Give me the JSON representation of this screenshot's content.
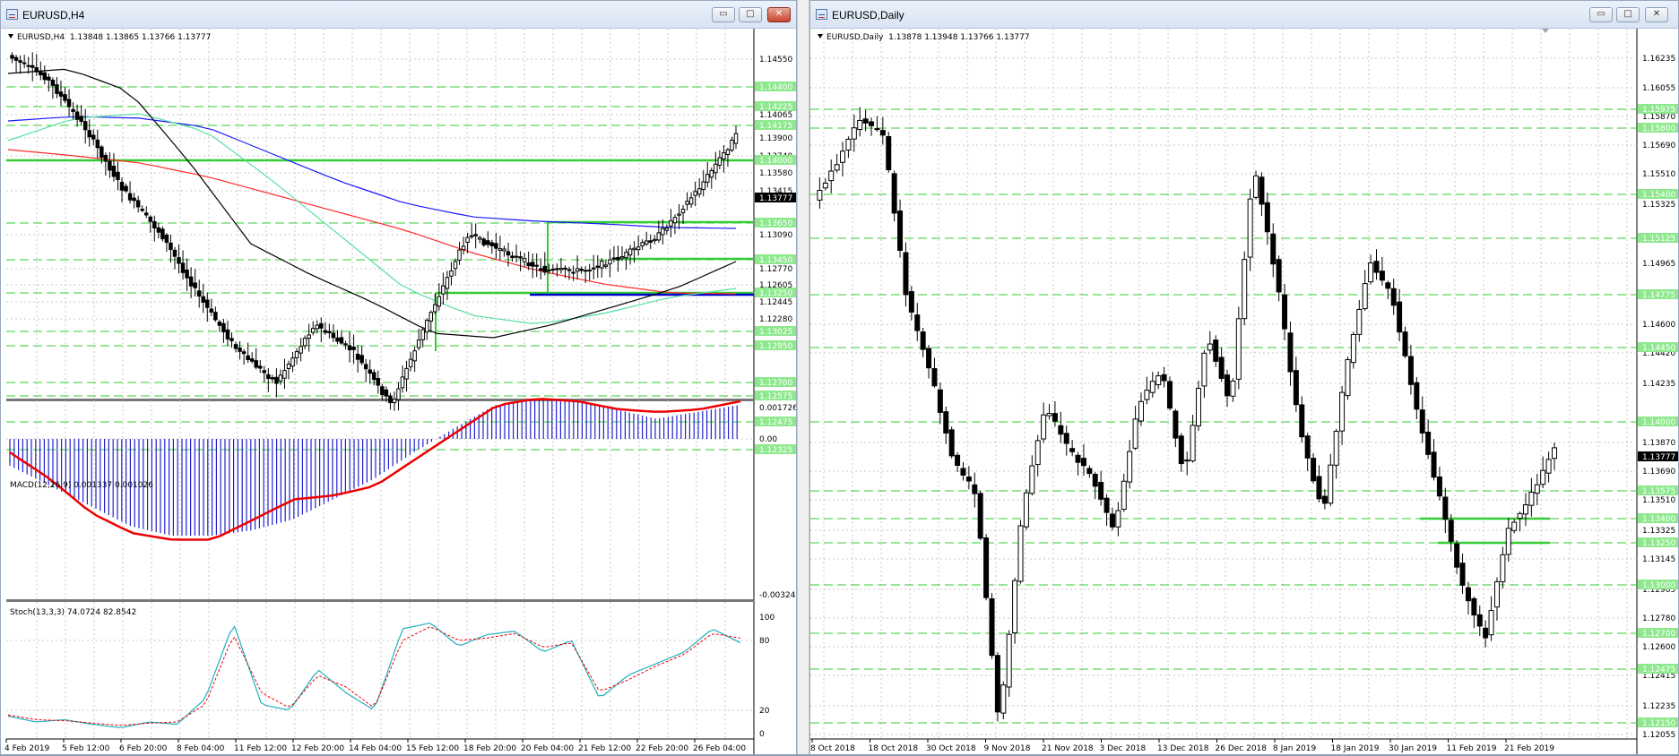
{
  "left_window": {
    "title": "EURUSD,H4",
    "info_symbol": "EURUSD,H4",
    "info_ohlc": "1.13848 1.13865 1.13766 1.13777",
    "price_labels": [
      "1.14550",
      "1.14225",
      "1.14065",
      "1.13900",
      "1.13740",
      "1.13580",
      "1.13415",
      "1.13090",
      "1.12770",
      "1.12605",
      "1.12445",
      "1.12280"
    ],
    "level_labels": [
      "1.14400",
      "1.14225",
      "1.14175",
      "1.14000",
      "1.13650",
      "1.13450",
      "1.13250",
      "1.13025",
      "1.12950",
      "1.12700",
      "1.12575",
      "1.12475",
      "1.12325"
    ],
    "current_price": "1.13777",
    "time_labels": [
      "4 Feb 2019",
      "5 Feb 12:00",
      "6 Feb 20:00",
      "8 Feb 04:00",
      "11 Feb 12:00",
      "12 Feb 20:00",
      "14 Feb 04:00",
      "15 Feb 12:00",
      "18 Feb 20:00",
      "20 Feb 04:00",
      "21 Feb 12:00",
      "22 Feb 20:00",
      "26 Feb 04:00"
    ],
    "macd": {
      "label": "MACD(12,26,9) 0.001337 0.001026",
      "scale": [
        "0.001726",
        "0.00",
        "-0.003242"
      ]
    },
    "stoch": {
      "label": "Stoch(13,3,3) 74.0724 82.8542",
      "scale": [
        "100",
        "80",
        "20",
        "0"
      ]
    }
  },
  "right_window": {
    "title": "EURUSD,Daily",
    "info_symbol": "EURUSD,Daily",
    "info_ohlc": "1.13878 1.13948 1.13766 1.13777",
    "price_labels": [
      "1.16235",
      "1.16055",
      "1.15870",
      "1.15690",
      "1.15510",
      "1.15325",
      "1.14965",
      "1.14600",
      "1.14420",
      "1.14235",
      "1.13870",
      "1.13690",
      "1.13510",
      "1.13325",
      "1.13145",
      "1.12965",
      "1.12780",
      "1.12600",
      "1.12415",
      "1.12235",
      "1.12055"
    ],
    "level_labels": [
      "1.15975",
      "1.15800",
      "1.15400",
      "1.15125",
      "1.14775",
      "1.14450",
      "1.14000",
      "1.13575",
      "1.13400",
      "1.13250",
      "1.13000",
      "1.12700",
      "1.12475",
      "1.12150"
    ],
    "current_price": "1.13777",
    "time_labels": [
      "8 Oct 2018",
      "18 Oct 2018",
      "30 Oct 2018",
      "9 Nov 2018",
      "21 Nov 2018",
      "3 Dec 2018",
      "13 Dec 2018",
      "26 Dec 2018",
      "8 Jan 2019",
      "18 Jan 2019",
      "30 Jan 2019",
      "11 Feb 2019",
      "21 Feb 2019"
    ]
  },
  "colors": {
    "candle": "#000000",
    "level_line": "#33cc33",
    "level_label_bg": "#8ee88e",
    "ma_blue": "#1a1aff",
    "ma_red": "#ff2a2a",
    "ma_green": "#55e0a0",
    "ma_black": "#000000",
    "support": "#0000cc",
    "macd_hist": "#2222cc",
    "macd_signal": "#ee0000",
    "stoch_main": "#20b0c0",
    "stoch_signal": "#ee0000"
  },
  "window_buttons": {
    "minimize": "▭",
    "maximize": "□",
    "close": "✕"
  }
}
